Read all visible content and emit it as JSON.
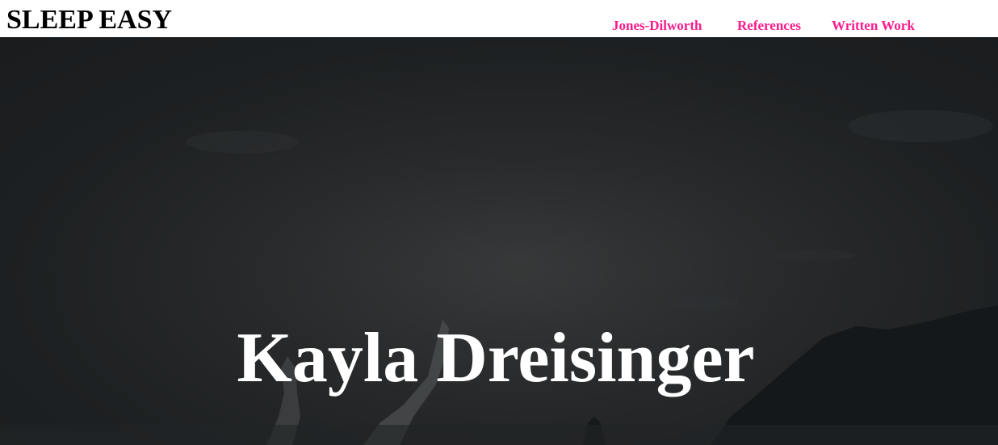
{
  "site": {
    "brand": "SLEEP EASY"
  },
  "nav": {
    "items": [
      {
        "label": "Jones-Dilworth"
      },
      {
        "label": "References"
      },
      {
        "label": "Written Work"
      }
    ]
  },
  "hero": {
    "title": "Kayla Dreisinger"
  },
  "colors": {
    "nav_link": "#ff1a8c",
    "hero_overlay": "#1d2022",
    "hero_title": "#ffffff"
  }
}
